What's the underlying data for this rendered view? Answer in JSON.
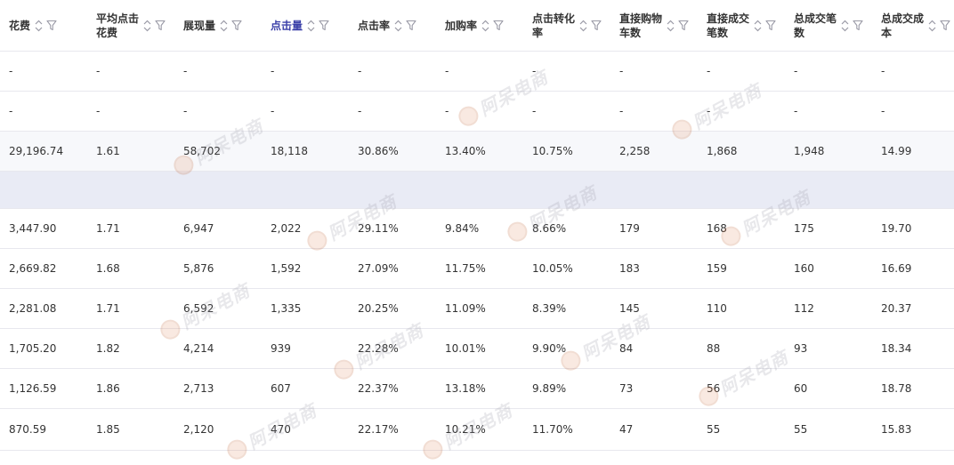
{
  "columns": [
    {
      "key": "spend",
      "line1": "花费",
      "line2": "",
      "active": false
    },
    {
      "key": "cpc",
      "line1": "平均点击",
      "line2": "花费",
      "active": false
    },
    {
      "key": "impressions",
      "line1": "展现量",
      "line2": "",
      "active": false
    },
    {
      "key": "clicks",
      "line1": "点击量",
      "line2": "",
      "active": true
    },
    {
      "key": "ctr",
      "line1": "点击率",
      "line2": "",
      "active": false
    },
    {
      "key": "add_cart_rate",
      "line1": "加购率",
      "line2": "",
      "active": false
    },
    {
      "key": "cvr",
      "line1": "点击转化",
      "line2": "率",
      "active": false
    },
    {
      "key": "direct_cart",
      "line1": "直接购物",
      "line2": "车数",
      "active": false
    },
    {
      "key": "direct_orders",
      "line1": "直接成交",
      "line2": "笔数",
      "active": false
    },
    {
      "key": "total_orders",
      "line1": "总成交笔",
      "line2": "数",
      "active": false
    },
    {
      "key": "total_cost",
      "line1": "总成交成",
      "line2": "本",
      "active": false
    }
  ],
  "rows": [
    {
      "kind": "normal",
      "cells": [
        "-",
        "-",
        "-",
        "-",
        "-",
        "-",
        "-",
        "-",
        "-",
        "-",
        "-"
      ]
    },
    {
      "kind": "normal",
      "cells": [
        "-",
        "-",
        "-",
        "-",
        "-",
        "-",
        "-",
        "-",
        "-",
        "-",
        "-"
      ]
    },
    {
      "kind": "highlight",
      "cells": [
        "29,196.74",
        "1.61",
        "58,702",
        "18,118",
        "30.86%",
        "13.40%",
        "10.75%",
        "2,258",
        "1,868",
        "1,948",
        "14.99"
      ]
    },
    {
      "kind": "group",
      "cells": [
        "",
        "",
        "",
        "",
        "",
        "",
        "",
        "",
        "",
        "",
        ""
      ]
    },
    {
      "kind": "normal",
      "cells": [
        "3,447.90",
        "1.71",
        "6,947",
        "2,022",
        "29.11%",
        "9.84%",
        "8.66%",
        "179",
        "168",
        "175",
        "19.70"
      ]
    },
    {
      "kind": "normal",
      "cells": [
        "2,669.82",
        "1.68",
        "5,876",
        "1,592",
        "27.09%",
        "11.75%",
        "10.05%",
        "183",
        "159",
        "160",
        "16.69"
      ]
    },
    {
      "kind": "normal",
      "cells": [
        "2,281.08",
        "1.71",
        "6,592",
        "1,335",
        "20.25%",
        "11.09%",
        "8.39%",
        "145",
        "110",
        "112",
        "20.37"
      ]
    },
    {
      "kind": "normal",
      "cells": [
        "1,705.20",
        "1.82",
        "4,214",
        "939",
        "22.28%",
        "10.01%",
        "9.90%",
        "84",
        "88",
        "93",
        "18.34"
      ]
    },
    {
      "kind": "normal",
      "cells": [
        "1,126.59",
        "1.86",
        "2,713",
        "607",
        "22.37%",
        "13.18%",
        "9.89%",
        "73",
        "56",
        "60",
        "18.78"
      ]
    },
    {
      "kind": "normal",
      "cells": [
        "870.59",
        "1.85",
        "2,120",
        "470",
        "22.17%",
        "10.21%",
        "11.70%",
        "47",
        "55",
        "55",
        "15.83"
      ]
    }
  ],
  "watermark": {
    "text": "阿呆电商"
  },
  "icons": {
    "sort": "sort-icon",
    "filter": "filter-icon"
  },
  "colors": {
    "active_header": "#3a3fa8",
    "group_row": "#e9ebf5",
    "highlight_row": "#f7f8fb",
    "border": "#e8e8ee",
    "text": "#333333",
    "icon": "#9a9aa6"
  }
}
